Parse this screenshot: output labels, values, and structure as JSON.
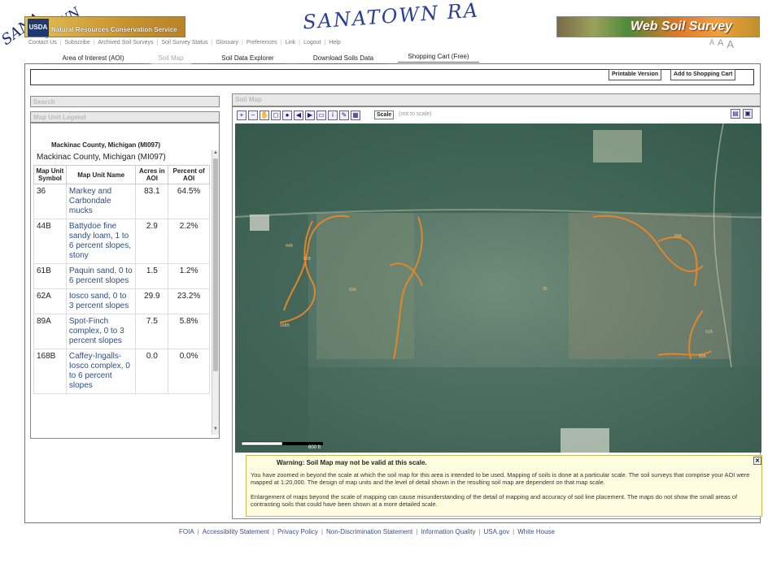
{
  "handwritten": {
    "title": "SANATOWN RA",
    "note_line1": "SANA",
    "note_line2": "TOWN"
  },
  "header": {
    "usda_logo": "USDA",
    "agency": "Natural Resources Conservation Service",
    "product": "Web Soil Survey",
    "nav": [
      "Contact Us",
      "Subscribe",
      "Archived Soil Surveys",
      "Soil Survey Status",
      "Glossary",
      "Preferences",
      "Link",
      "Logout",
      "Help"
    ],
    "text_sizes": [
      "A",
      "A",
      "A"
    ]
  },
  "tabs": [
    "Area of Interest (AOI)",
    "Soil Map",
    "Soil Data Explorer",
    "Download Soils Data",
    "Shopping Cart (Free)"
  ],
  "toolbar": {
    "printable_label": "Printable Version",
    "add_cart_label": "Add to Shopping Cart"
  },
  "left": {
    "search_label": "Search",
    "legend_label": "Map Unit Legend",
    "county_header": "Mackinac County, Michigan (MI097)",
    "county_sub": "Mackinac County, Michigan (MI097)",
    "columns": [
      "Map Unit Symbol",
      "Map Unit Name",
      "Acres in AOI",
      "Percent of AOI"
    ],
    "rows": [
      {
        "symbol": "36",
        "name": "Markey and Carbondale mucks",
        "acres": "83.1",
        "percent": "64.5%"
      },
      {
        "symbol": "44B",
        "name": "Battydoe fine sandy loam, 1 to 6 percent slopes, stony",
        "acres": "2.9",
        "percent": "2.2%"
      },
      {
        "symbol": "61B",
        "name": "Paquin sand, 0 to 6 percent slopes",
        "acres": "1.5",
        "percent": "1.2%"
      },
      {
        "symbol": "62A",
        "name": "Iosco sand, 0 to 3 percent slopes",
        "acres": "29.9",
        "percent": "23.2%"
      },
      {
        "symbol": "89A",
        "name": "Spot-Finch complex, 0 to 3 percent slopes",
        "acres": "7.5",
        "percent": "5.8%"
      },
      {
        "symbol": "168B",
        "name": "Caffey-Ingalls-Iosco complex, 0 to 6 percent slopes",
        "acres": "0.0",
        "percent": "0.0%"
      }
    ]
  },
  "map": {
    "title": "Soil Map",
    "scale_button": "Scale",
    "scale_text": "(not to scale)",
    "scale_bar_label": "600 ft",
    "unit_labels": [
      "44B",
      "61B",
      "62A",
      "168B",
      "36",
      "89A",
      "61B",
      "89A"
    ],
    "tool_icons": [
      "zoom-in-icon",
      "zoom-out-icon",
      "pan-icon",
      "aoi-icon",
      "identify-icon",
      "back-icon",
      "forward-icon",
      "full-extent-icon",
      "info-icon",
      "legend-icon",
      "clear-icon"
    ],
    "boundary_color": "#e2862a"
  },
  "warning": {
    "title": "Warning: Soil Map may not be valid at this scale.",
    "p1": "You have zoomed in beyond the scale at which the soil map for this area is intended to be used. Mapping of soils is done at a particular scale. The soil surveys that comprise your AOI were mapped at 1:20,000. The design of map units and the level of detail shown in the resulting soil map are dependent on that map scale.",
    "p2": "Enlargement of maps beyond the scale of mapping can cause misunderstanding of the detail of mapping and accuracy of soil line placement. The maps do not show the small areas of contrasting soils that could have been shown at a more detailed scale.",
    "close": "×"
  },
  "footer": [
    "FOIA",
    "Accessibility Statement",
    "Privacy Policy",
    "Non-Discrimination Statement",
    "Information Quality",
    "USA.gov",
    "White House"
  ]
}
